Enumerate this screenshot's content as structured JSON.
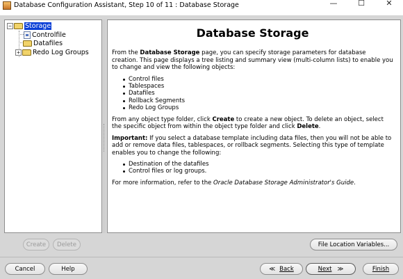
{
  "window": {
    "title": "Database Configuration Assistant, Step 10 of 11 : Database Storage",
    "controls": {
      "minimize": "—",
      "maximize": "☐",
      "close": "✕"
    }
  },
  "tree": {
    "root": {
      "label": "Storage",
      "expander": "−"
    },
    "items": [
      {
        "label": "Controlfile"
      },
      {
        "label": "Datafiles"
      },
      {
        "label": "Redo Log Groups",
        "expander": "+"
      }
    ]
  },
  "content": {
    "title": "Database Storage",
    "intro_pre": "From the ",
    "intro_bold": "Database Storage",
    "intro_post": " page, you can specify storage parameters for database creation. This page displays a tree listing and summary view (multi-column lists) to enable you to change and view the following objects:",
    "objects": [
      "Control files",
      "Tablespaces",
      "Datafiles",
      "Rollback Segments",
      "Redo Log Groups"
    ],
    "create_pre": "From any object type folder, click ",
    "create_bold": "Create",
    "create_mid": " to create a new object. To delete an object, select the specific object from within the object type folder and click ",
    "create_bold2": "Delete",
    "create_post": ".",
    "important_bold": "Important:",
    "important_text": " If you select a database template including data files, then you will not be able to add or remove data files, tablespaces, or rollback segments. Selecting this type of template enables you to change the following:",
    "changeable": [
      "Destination of the datafiles",
      "Control files or log groups."
    ],
    "more_pre": "For more information, refer to the ",
    "more_italic": "Oracle Database Storage Administrator's Guide",
    "more_post": "."
  },
  "buttons": {
    "create": "Create",
    "delete": "Delete",
    "file_location_variables": "File Location Variables...",
    "cancel": "Cancel",
    "help": "Help",
    "back_arrow": "≪",
    "back": "Back",
    "next": "Next",
    "next_arrow": "≫",
    "finish": "Finish"
  }
}
